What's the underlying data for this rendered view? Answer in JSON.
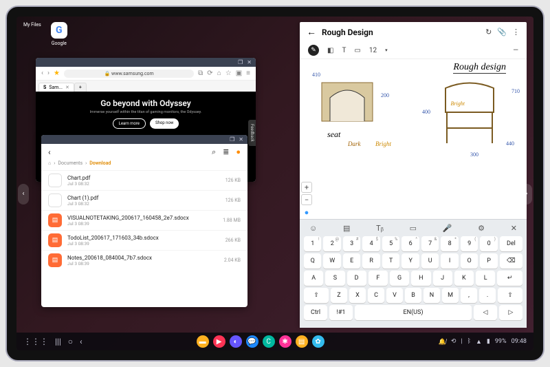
{
  "desktop": {
    "icons": [
      {
        "label": "My Files"
      },
      {
        "label": "Google"
      }
    ]
  },
  "browser": {
    "url_prefix": "🔒",
    "url": "www.samsung.com",
    "tab": {
      "favicon": "S",
      "label": "Sam...",
      "close": "✕"
    },
    "newtab": "+",
    "toolbar_icons": [
      "⇤",
      "⇥",
      "★",
      "⧉",
      "⟳",
      "⌂",
      "☆",
      "▣",
      "⋯"
    ],
    "hero": {
      "title": "Go beyond with Odyssey",
      "sub": "Immerse yourself within the titan of gaming monitors, the Odyssey.",
      "learn": "Learn more",
      "shop": "Shop now"
    },
    "feedback": "Feedback"
  },
  "files": {
    "back": "‹",
    "search": "⌕",
    "view": "≣",
    "more": "●",
    "breadcrumb": [
      "⌂",
      "›",
      "Documents",
      "›"
    ],
    "bc_current": "Download",
    "items": [
      {
        "name": "Chart.pdf",
        "date": "Jul 3 08:32",
        "size": "126 KB",
        "thumb": true
      },
      {
        "name": "Chart (1).pdf",
        "date": "Jul 3 08:32",
        "size": "126 KB",
        "thumb": true
      },
      {
        "name": "VISUALNOTETAKING_200617_160458_2e7.sdocx",
        "date": "Jul 3 08:39",
        "size": "1.88 MB",
        "thumb": false
      },
      {
        "name": "TodoList_200617_171603_34b.sdocx",
        "date": "Jul 3 08:39",
        "size": "266 KB",
        "thumb": false
      },
      {
        "name": "Notes_200618_084004_7b7.sdocx",
        "date": "Jul 3 08:39",
        "size": "2.04 KB",
        "thumb": false
      }
    ]
  },
  "notes": {
    "title": "Rough Design",
    "title_script": "Rough design",
    "seat": "seat",
    "dark": "Dark",
    "bright": "Bright",
    "bright2": "Bright",
    "m410": "410",
    "m200": "200",
    "m400": "400",
    "m300": "300",
    "m710": "710",
    "m440": "440",
    "zoom_label": "12",
    "kbd_lang": "EN(US)",
    "row1_sup": [
      "!",
      "@",
      "#",
      "$",
      "%",
      "^",
      "&",
      "*",
      "(",
      ")",
      "~"
    ],
    "row1": [
      "1",
      "2",
      "3",
      "4",
      "5",
      "6",
      "7",
      "8",
      "9",
      "0",
      "Del"
    ],
    "row2": [
      "Q",
      "W",
      "E",
      "R",
      "T",
      "Y",
      "U",
      "I",
      "O",
      "P"
    ],
    "row3": [
      "A",
      "S",
      "D",
      "F",
      "G",
      "H",
      "J",
      "K",
      "L"
    ],
    "row4": [
      "Z",
      "X",
      "C",
      "V",
      "B",
      "N",
      "M"
    ],
    "ctrl": "Ctrl",
    "sym": "!#1"
  },
  "taskbar": {
    "battery": "99%",
    "time": "09:48",
    "apps_colors": [
      "#ffb020",
      "#ff3355",
      "#6655ff",
      "#1e88ff",
      "#00b8a0",
      "#ff3399",
      "#ffb020",
      "#33bbee"
    ]
  }
}
